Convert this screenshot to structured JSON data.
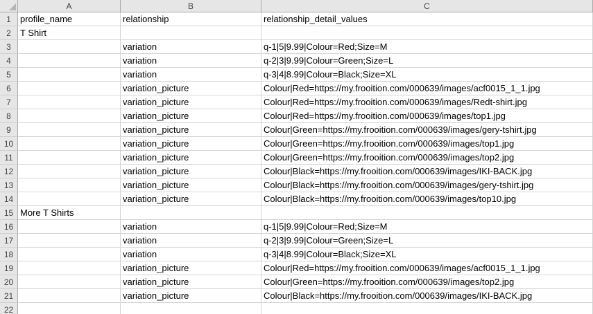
{
  "columns": [
    "A",
    "B",
    "C"
  ],
  "rows": [
    {
      "num": "1",
      "a": "profile_name",
      "b": "relationship",
      "c": "relationship_detail_values"
    },
    {
      "num": "2",
      "a": "T Shirt",
      "b": "",
      "c": ""
    },
    {
      "num": "3",
      "a": "",
      "b": "variation",
      "c": "q-1|5|9.99|Colour=Red;Size=M"
    },
    {
      "num": "4",
      "a": "",
      "b": "variation",
      "c": "q-2|3|9.99|Colour=Green;Size=L"
    },
    {
      "num": "5",
      "a": "",
      "b": "variation",
      "c": "q-3|4|8.99|Colour=Black;Size=XL"
    },
    {
      "num": "6",
      "a": "",
      "b": "variation_picture",
      "c": "Colour|Red=https://my.frooition.com/000639/images/acf0015_1_1.jpg"
    },
    {
      "num": "7",
      "a": "",
      "b": "variation_picture",
      "c": "Colour|Red=https://my.frooition.com/000639/images/Redt-shirt.jpg"
    },
    {
      "num": "8",
      "a": "",
      "b": "variation_picture",
      "c": "Colour|Red=https://my.frooition.com/000639/images/top1.jpg"
    },
    {
      "num": "9",
      "a": "",
      "b": "variation_picture",
      "c": "Colour|Green=https://my.frooition.com/000639/images/gery-tshirt.jpg"
    },
    {
      "num": "10",
      "a": "",
      "b": "variation_picture",
      "c": "Colour|Green=https://my.frooition.com/000639/images/top1.jpg"
    },
    {
      "num": "11",
      "a": "",
      "b": "variation_picture",
      "c": "Colour|Green=https://my.frooition.com/000639/images/top2.jpg"
    },
    {
      "num": "12",
      "a": "",
      "b": "variation_picture",
      "c": "Colour|Black=https://my.frooition.com/000639/images/IKI-BACK.jpg"
    },
    {
      "num": "13",
      "a": "",
      "b": "variation_picture",
      "c": "Colour|Black=https://my.frooition.com/000639/images/gery-tshirt.jpg"
    },
    {
      "num": "14",
      "a": "",
      "b": "variation_picture",
      "c": "Colour|Black=https://my.frooition.com/000639/images/top10.jpg"
    },
    {
      "num": "15",
      "a": "More T Shirts",
      "b": "",
      "c": ""
    },
    {
      "num": "16",
      "a": "",
      "b": "variation",
      "c": "q-1|5|9.99|Colour=Red;Size=M"
    },
    {
      "num": "17",
      "a": "",
      "b": "variation",
      "c": "q-2|3|9.99|Colour=Green;Size=L"
    },
    {
      "num": "18",
      "a": "",
      "b": "variation",
      "c": "q-3|4|8.99|Colour=Black;Size=XL"
    },
    {
      "num": "19",
      "a": "",
      "b": "variation_picture",
      "c": "Colour|Red=https://my.frooition.com/000639/images/acf0015_1_1.jpg"
    },
    {
      "num": "20",
      "a": "",
      "b": "variation_picture",
      "c": "Colour|Green=https://my.frooition.com/000639/images/top2.jpg"
    },
    {
      "num": "21",
      "a": "",
      "b": "variation_picture",
      "c": "Colour|Black=https://my.frooition.com/000639/images/IKI-BACK.jpg"
    },
    {
      "num": "22",
      "a": "",
      "b": "",
      "c": ""
    }
  ]
}
